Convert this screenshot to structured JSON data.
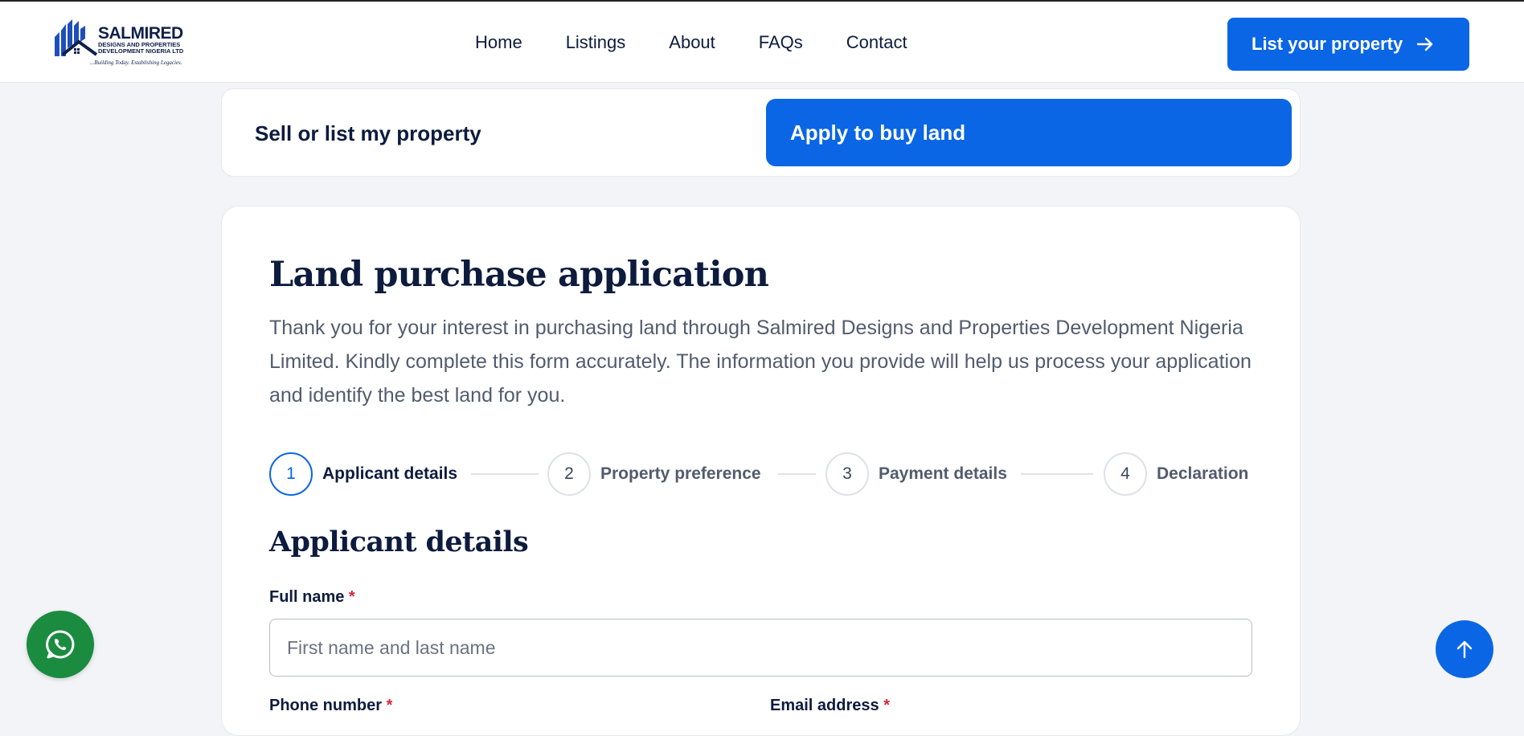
{
  "header": {
    "logo": {
      "name": "SALMIRED",
      "sub_line_1": "DESIGNS AND PROPERTIES",
      "sub_line_2": "DEVELOPMENT NIGERIA LTD",
      "tagline": "...Building Today. Establishing Legacies."
    },
    "nav": [
      "Home",
      "Listings",
      "About",
      "FAQs",
      "Contact"
    ],
    "cta_label": "List your property"
  },
  "tabs": {
    "sell_label": "Sell or list my property",
    "buy_label": "Apply to buy land",
    "active": "buy"
  },
  "form": {
    "title": "Land purchase application",
    "intro": "Thank you for your interest in purchasing land through Salmired Designs and Properties Development Nigeria Limited. Kindly complete this form accurately. The information you provide will help us process your application and identify the best land for you.",
    "steps": [
      {
        "number": "1",
        "label": "Applicant details",
        "active": true
      },
      {
        "number": "2",
        "label": "Property preference",
        "active": false
      },
      {
        "number": "3",
        "label": "Payment details",
        "active": false
      },
      {
        "number": "4",
        "label": "Declaration",
        "active": false
      }
    ],
    "section_title": "Applicant details",
    "full_name": {
      "label": "Full name",
      "required_mark": "*",
      "placeholder": "First name and last name",
      "value": ""
    },
    "phone": {
      "label": "Phone number",
      "required_mark": "*"
    },
    "email": {
      "label": "Email address",
      "required_mark": "*"
    }
  },
  "colors": {
    "primary": "#0a66e4",
    "whatsapp": "#1a8b3f",
    "heading": "#0d1b3d",
    "required": "#d6263c"
  },
  "floating": {
    "whatsapp_icon": "whatsapp-icon",
    "scroll_top_icon": "arrow-up-icon"
  }
}
